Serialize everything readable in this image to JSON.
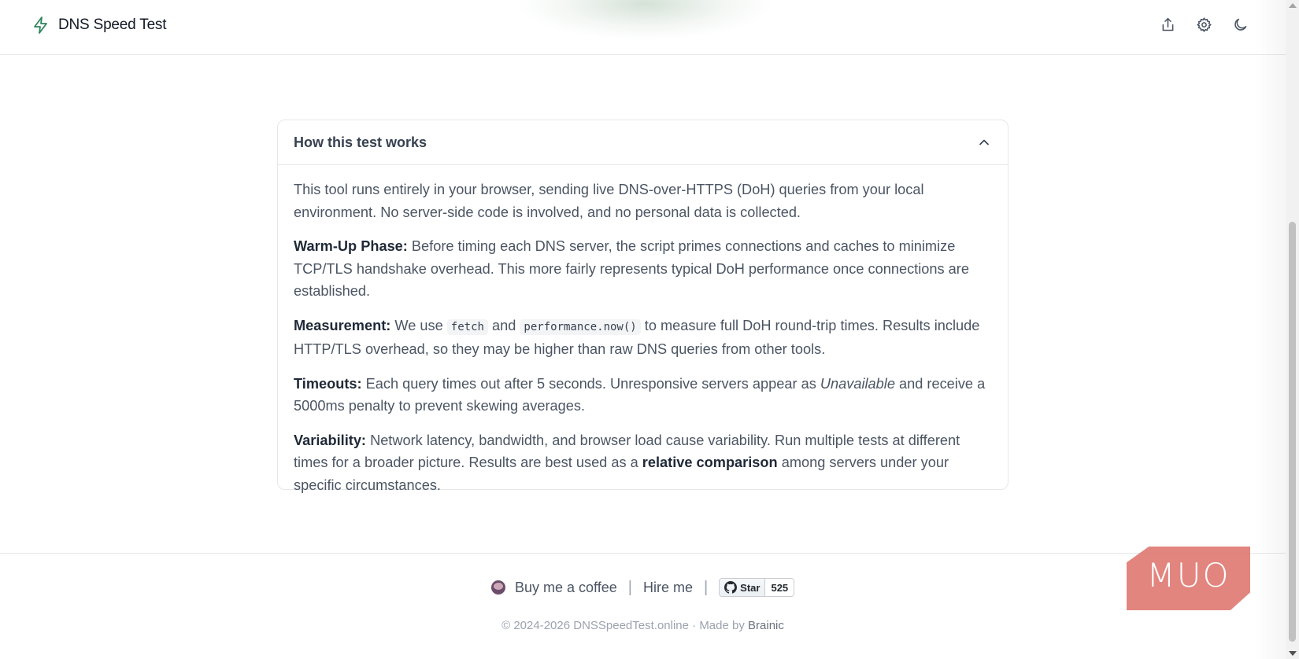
{
  "header": {
    "title": "DNS Speed Test",
    "brand_icon": "lightning-icon",
    "actions": [
      {
        "icon": "share-icon",
        "label": "Share"
      },
      {
        "icon": "gear-icon",
        "label": "Settings"
      },
      {
        "icon": "moon-icon",
        "label": "Dark mode"
      }
    ]
  },
  "accordion": {
    "title": "How this test works",
    "expanded": true,
    "intro": "This tool runs entirely in your browser, sending live DNS-over-HTTPS (DoH) queries from your local environment. No server-side code is involved, and no personal data is collected.",
    "warmup": {
      "label": "Warm-Up Phase:",
      "text": "Before timing each DNS server, the script primes connections and caches to minimize TCP/TLS handshake overhead. This more fairly represents typical DoH performance once connections are established."
    },
    "measurement": {
      "label": "Measurement:",
      "text_a": "We use",
      "code_a": "fetch",
      "text_b": "and",
      "code_b": "performance.now()",
      "text_c": "to measure full DoH round-trip times. Results include HTTP/TLS overhead, so they may be higher than raw DNS queries from other tools."
    },
    "timeouts": {
      "label": "Timeouts:",
      "text_a": "Each query times out after 5 seconds. Unresponsive servers appear as",
      "emph": "Unavailable",
      "text_b": "and receive a 5000ms penalty to prevent skewing averages."
    },
    "variability": {
      "label": "Variability:",
      "text_a": "Network latency, bandwidth, and browser load cause variability. Run multiple tests at different times for a broader picture. Results are best used as a",
      "strong": "relative comparison",
      "text_b": "among servers under your specific circumstances."
    }
  },
  "footer": {
    "coffee_label": "Buy me a coffee",
    "hire_label": "Hire me",
    "separator": "|",
    "github": {
      "star_label": "Star",
      "count": "525"
    },
    "copyright": "© 2024-2026 DNSSpeedTest.online · Made by",
    "author": "Brainic"
  },
  "watermark": {
    "text": "MUO"
  },
  "colors": {
    "accent": "#2f855a",
    "watermark": "#e07b73"
  }
}
